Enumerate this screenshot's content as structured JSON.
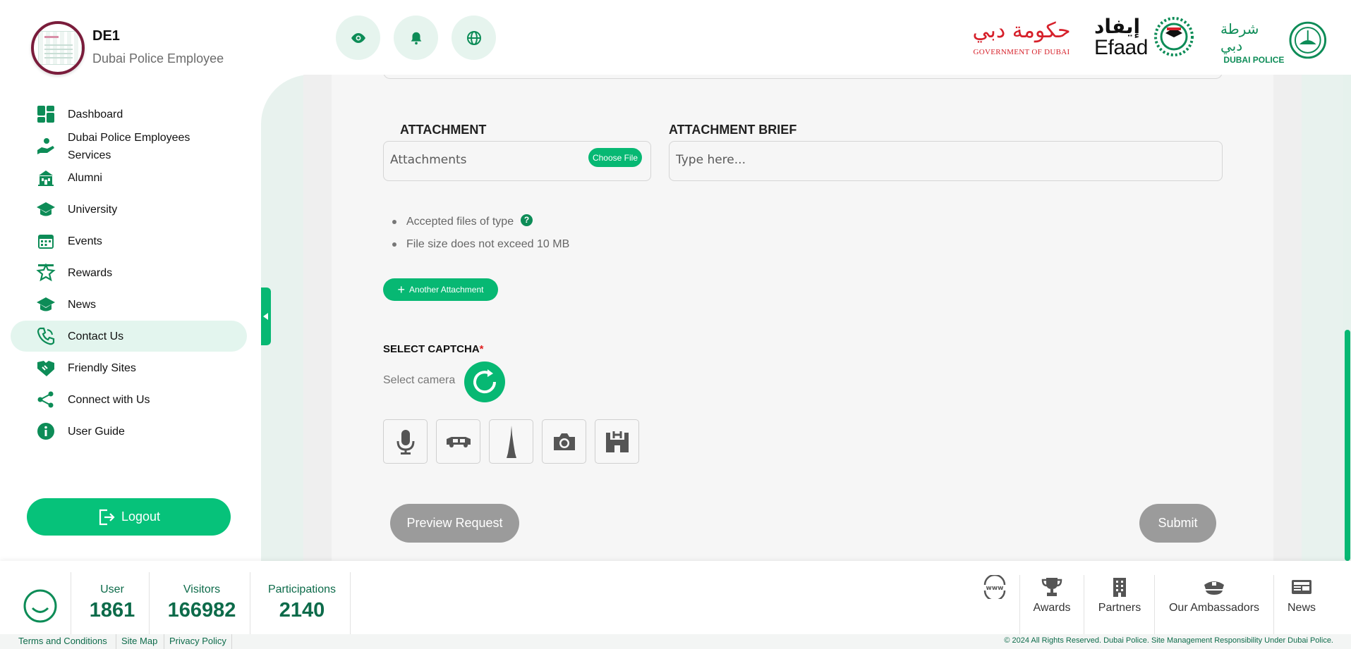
{
  "user": {
    "name": "DE1",
    "role": "Dubai Police Employee"
  },
  "header": {
    "buttons": [
      "eye-icon",
      "bell-icon",
      "globe-icon"
    ],
    "logos": {
      "government": {
        "arabic": "حكومة دبي",
        "english": "GOVERNMENT OF DUBAI"
      },
      "efaad": {
        "arabic": "إيفاد",
        "english": "Efaad"
      },
      "police": {
        "arabic": "شرطة دبي",
        "english": "DUBAI POLICE"
      }
    }
  },
  "sidebar": {
    "items": [
      {
        "label": "Dashboard",
        "icon": "dashboard-icon"
      },
      {
        "label": "Dubai Police Employees",
        "label2": "Services",
        "icon": "hand-service-icon"
      },
      {
        "label": "Alumni",
        "icon": "building-icon"
      },
      {
        "label": "University",
        "icon": "graduation-cap-icon"
      },
      {
        "label": "Events",
        "icon": "calendar-icon"
      },
      {
        "label": "Rewards",
        "icon": "star-icon"
      },
      {
        "label": "News",
        "icon": "graduation-cap-icon"
      },
      {
        "label": "Contact Us",
        "icon": "phone-icon",
        "active": true
      },
      {
        "label": "Friendly Sites",
        "icon": "handshake-icon"
      },
      {
        "label": "Connect with Us",
        "icon": "share-icon"
      },
      {
        "label": "User Guide",
        "icon": "info-icon"
      }
    ],
    "logout_label": "Logout"
  },
  "form": {
    "attachment_label": "ATTACHMENT",
    "attachment_placeholder": "Attachments",
    "choose_file_label": "Choose File",
    "brief_label": "ATTACHMENT BRIEF",
    "brief_placeholder": "Type here...",
    "bullets": [
      "Accepted files of type",
      "File size does not exceed 10 MB"
    ],
    "help_glyph": "?",
    "another_attachment_label": "Another Attachment",
    "captcha_title": "SELECT CAPTCHA",
    "captcha_required": "*",
    "captcha_hint": "Select camera",
    "captcha_options": [
      "microphone-icon",
      "car-icon",
      "burj-khalifa-icon",
      "camera-icon",
      "helipad-building-icon"
    ],
    "preview_label": "Preview Request",
    "submit_label": "Submit"
  },
  "footer": {
    "stats": [
      {
        "label": "User",
        "value": "1861"
      },
      {
        "label": "Visitors",
        "value": "166982"
      },
      {
        "label": "Participations",
        "value": "2140"
      }
    ],
    "links": [
      {
        "label": "",
        "icon": "www-globe-icon"
      },
      {
        "label": "Awards",
        "icon": "trophy-icon"
      },
      {
        "label": "Partners",
        "icon": "office-building-icon"
      },
      {
        "label": "Our Ambassadors",
        "icon": "officer-cap-icon"
      },
      {
        "label": "News",
        "icon": "newspaper-icon"
      }
    ],
    "bottom_links": [
      "Terms and Conditions",
      "Site Map",
      "Privacy Policy"
    ],
    "copyright": "© 2024 All Rights Reserved. Dubai Police. Site Management Responsibility Under Dubai Police."
  },
  "colors": {
    "accent": "#07b873",
    "accent_dark": "#0d8c57",
    "text_green": "#0d6b4a",
    "disabled": "#9b9b9b"
  }
}
